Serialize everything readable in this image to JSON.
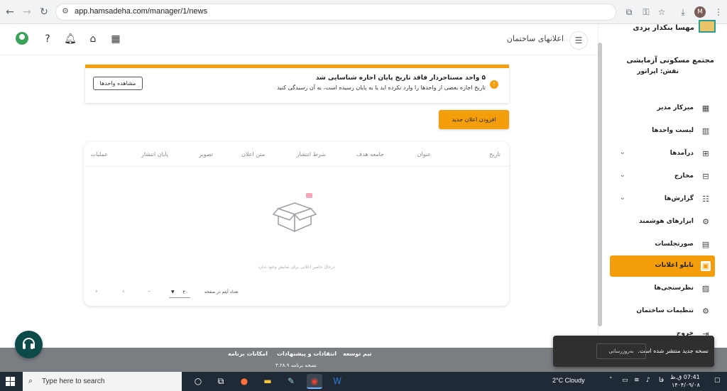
{
  "browser": {
    "url": "app.hamsadeha.com/manager/1/news",
    "profile_initial": "M"
  },
  "header": {
    "page_title": "اعلانهای ساختمان"
  },
  "alert": {
    "title": "۵ واحد مستاجردار فاقد تاریخ پایان اجاره شناسایی شد",
    "description": "تاریخ اجاره بعضی از واحدها را وارد نکرده اید یا به پایان رسیده است، به آن رسیدگی کنید",
    "button_label": "مشاهده واحدها",
    "icon_glyph": "!"
  },
  "actions": {
    "add_news_label": "افزودن اعلان جدید"
  },
  "table": {
    "columns": [
      "تاریخ",
      "عنوان",
      "جامعه هدف",
      "شرط انتشار",
      "متن اعلان",
      "تصویر",
      "پایان انتشار",
      "عملیات"
    ],
    "empty_message": "درحال حاضر اعلانی برای نمایش وجود ندارد",
    "per_page_label": "تعداد آیتم در صفحه",
    "per_page_value": "۲۰",
    "range_text": "–"
  },
  "sidebar": {
    "brand_name": "مهسا بنکدار یزدی",
    "complex_name": "مجتمع مسکونی آزمایشی",
    "role": "نقش: اپراتور",
    "items": [
      {
        "label": "میزکار مدیر",
        "icon": "dashboard-icon",
        "glyph": "▦"
      },
      {
        "label": "لیست واحدها",
        "icon": "building-icon",
        "glyph": "▥"
      },
      {
        "label": "درآمدها",
        "icon": "income-icon",
        "glyph": "⊞"
      },
      {
        "label": "مخارج",
        "icon": "expense-icon",
        "glyph": "⊟"
      },
      {
        "label": "گزارش‌ها",
        "icon": "report-icon",
        "glyph": "☷"
      },
      {
        "label": "ابزارهای هوشمند",
        "icon": "smart-tools-icon",
        "glyph": "⚙"
      },
      {
        "label": "صورتجلسات",
        "icon": "minutes-icon",
        "glyph": "▤"
      },
      {
        "label": "تابلو اعلانات",
        "icon": "notice-board-icon",
        "glyph": "▣"
      },
      {
        "label": "نظرسنجی‌ها",
        "icon": "poll-icon",
        "glyph": "▨"
      },
      {
        "label": "تنظیمات ساختمان",
        "icon": "settings-icon",
        "glyph": "⚙"
      },
      {
        "label": "خروج",
        "icon": "logout-icon",
        "glyph": "⇥"
      }
    ],
    "active_index": 7
  },
  "footer": {
    "links": [
      "تیم توسعه",
      "انتقادات و پیشنهادات",
      "امکانات برنامه"
    ],
    "version": "نسخه برنامه ۳.۲۸.۹"
  },
  "toast": {
    "message": "نسخه جدید منتشر شده است.",
    "button_label": "به‌روزرسانی"
  },
  "taskbar": {
    "search_placeholder": "Type here to search",
    "weather": "2°C  Cloudy",
    "lang": "فا",
    "time": "07:41 ق.ظ",
    "date": "۱۴۰۴/۰۹/۰۸"
  },
  "colors": {
    "accent": "#f59e0b",
    "footer": "#7a7d82",
    "support": "#0d4a4a"
  }
}
